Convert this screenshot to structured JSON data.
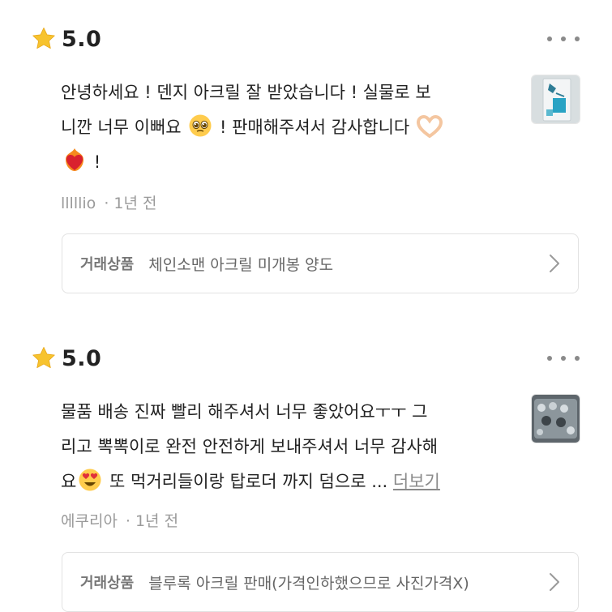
{
  "reviews": [
    {
      "rating": "5.0",
      "text_line1": "안녕하세요 ! 덴지 아크릴 잘 받았습니다 ! 실물로 보",
      "text_line2_a": "니깐 너무 이뻐요",
      "text_line2_b": "! 판매해주셔서 감사합니다",
      "text_line3": "!",
      "emojis": [
        "pleading-face",
        "heart-hands",
        "heart-on-fire"
      ],
      "username": "lllllio",
      "time": "1년 전",
      "product_label": "거래상품",
      "product_name": "체인소맨 아크릴 미개봉 양도"
    },
    {
      "rating": "5.0",
      "text_line1": "물품 배송 진짜 빨리 해주셔서 너무 좋았어요ㅜㅜ 그",
      "text_line2": "리고 뽁뽁이로 완전 안전하게 보내주셔서 너무 감사해",
      "text_line3_a": "요",
      "text_line3_b": "또 먹거리들이랑 탑로더 까지 덤으로  ...",
      "more_label": "더보기",
      "emojis": [
        "heart-eyes"
      ],
      "username": "에쿠리아",
      "time": "1년 전",
      "product_label": "거래상품",
      "product_name": "블루록 아크릴 판매(가격인하했으므로 사진가격X)"
    }
  ],
  "colors": {
    "star": "#F7C32E",
    "text": "#222222",
    "meta": "#9A9A9A",
    "border": "#E2E2E2"
  }
}
